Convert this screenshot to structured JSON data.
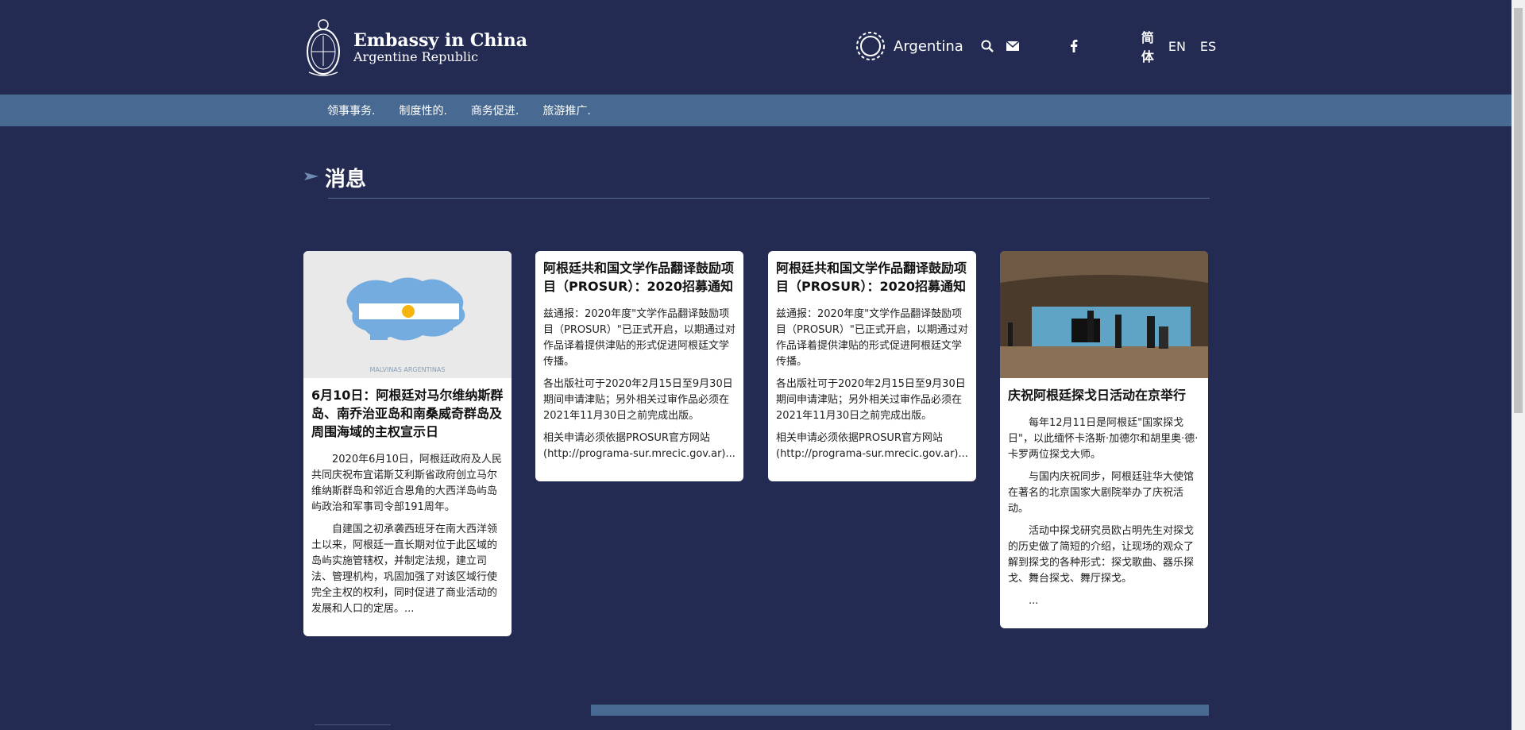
{
  "header": {
    "title": "Embassy in China",
    "subtitle": "Argentine Republic",
    "brand": "Argentina",
    "languages": [
      "简体",
      "EN",
      "ES"
    ],
    "icons": [
      "search-icon",
      "mail-icon",
      "facebook-icon"
    ]
  },
  "nav": {
    "items": [
      "领事事务.",
      "制度性的.",
      "商务促进.",
      "旅游推广."
    ]
  },
  "section": {
    "title": "消息"
  },
  "cards": [
    {
      "title": "6月10日：阿根廷对马尔维纳斯群岛、南乔治亚岛和南桑威奇群岛及周围海域的主权宣示日",
      "image_caption": "MALVINAS ARGENTINAS",
      "paragraphs": [
        "2020年6月10日，阿根廷政府及人民共同庆祝布宜诺斯艾利斯省政府创立马尔维纳斯群岛和邻近合恩角的大西洋岛屿岛屿政治和军事司令部191周年。",
        "自建国之初承袭西班牙在南大西洋领土以来，阿根廷一直长期对位于此区域的岛屿实施管辖权，并制定法规，建立司法、管理机构，巩固加强了对该区域行使完全主权的权利，同时促进了商业活动的发展和人口的定居。..."
      ]
    },
    {
      "title": "阿根廷共和国文学作品翻译鼓励项目（PROSUR）：2020招募通知",
      "paragraphs": [
        "兹通报：2020年度\"文学作品翻译鼓励项目（PROSUR）\"已正式开启，以期通过对作品译着提供津贴的形式促进阿根廷文学传播。",
        "各出版社可于2020年2月15日至9月30日期间申请津贴；另外相关过审作品必须在2021年11月30日之前完成出版。",
        "相关申请必须依据PROSUR官方网站(http://programa-sur.mrecic.gov.ar)..."
      ]
    },
    {
      "title": "阿根廷共和国文学作品翻译鼓励项目（PROSUR）：2020招募通知",
      "paragraphs": [
        "兹通报：2020年度\"文学作品翻译鼓励项目（PROSUR）\"已正式开启，以期通过对作品译着提供津贴的形式促进阿根廷文学传播。",
        "各出版社可于2020年2月15日至9月30日期间申请津贴；另外相关过审作品必须在2021年11月30日之前完成出版。",
        "相关申请必须依据PROSUR官方网站(http://programa-sur.mrecic.gov.ar)..."
      ]
    },
    {
      "title": "庆祝阿根廷探戈日活动在京举行",
      "paragraphs": [
        "每年12月11日是阿根廷\"国家探戈日\"，以此缅怀卡洛斯·加德尔和胡里奥·德·卡罗两位探戈大师。",
        "与国内庆祝同步，阿根廷驻华大使馆在著名的北京国家大剧院举办了庆祝活动。",
        "活动中探戈研究员欧占明先生对探戈的历史做了简短的介绍，让现场的观众了解到探戈的各种形式：探戈歌曲、器乐探戈、舞台探戈、舞厅探戈。",
        "..."
      ]
    }
  ],
  "colors": {
    "background": "#232b52",
    "navbar": "#486a92",
    "card": "#ffffff",
    "flag_blue": "#74acdf"
  }
}
